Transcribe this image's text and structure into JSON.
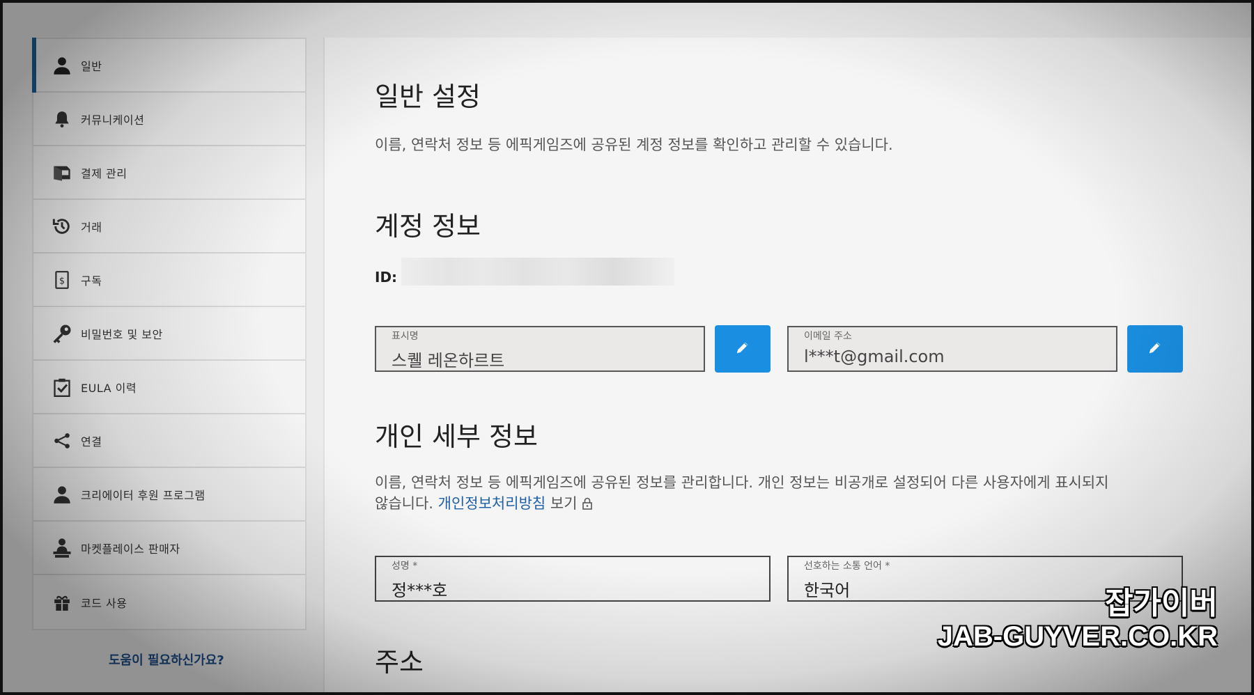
{
  "sidebar": {
    "items": [
      {
        "label": "일반",
        "icon": "user-icon",
        "active": true
      },
      {
        "label": "커뮤니케이션",
        "icon": "bell-icon"
      },
      {
        "label": "결제 관리",
        "icon": "wallet-icon"
      },
      {
        "label": "거래",
        "icon": "history-icon"
      },
      {
        "label": "구독",
        "icon": "subscription-icon"
      },
      {
        "label": "비밀번호 및 보안",
        "icon": "key-icon"
      },
      {
        "label": "EULA 이력",
        "icon": "clipboard-check-icon"
      },
      {
        "label": "연결",
        "icon": "share-icon"
      },
      {
        "label": "크리에이터 후원 프로그램",
        "icon": "creator-icon"
      },
      {
        "label": "마켓플레이스 판매자",
        "icon": "seller-icon"
      },
      {
        "label": "코드 사용",
        "icon": "gift-icon"
      }
    ],
    "help": "도움이 필요하신가요?"
  },
  "main": {
    "title": "일반 설정",
    "description": "이름, 연락처 정보 등 에픽게임즈에 공유된 계정 정보를 확인하고 관리할 수 있습니다.",
    "account_section": {
      "title": "계정 정보",
      "id_label": "ID:",
      "display_name": {
        "label": "표시명",
        "value": "스퀠 레온하르트"
      },
      "email": {
        "label": "이메일 주소",
        "value": "l***t@gmail.com"
      }
    },
    "personal_section": {
      "title": "개인 세부 정보",
      "description_1": "이름, 연락처 정보 등 에픽게임즈에 공유된 정보를 관리합니다. 개인 정보는 비공개로 설정되어 다른 사용자에게 표시되지",
      "description_2": "않습니다.",
      "privacy_link": "개인정보처리방침",
      "privacy_suffix": "보기",
      "name": {
        "label": "성명 *",
        "value": "정***호"
      },
      "language": {
        "label": "선호하는 소통 언어 *",
        "value": "한국어"
      }
    },
    "address_section": {
      "title": "주소"
    }
  },
  "watermark": {
    "line1": "잡가이버",
    "line2": "JAB-GUYVER.CO.KR"
  },
  "colors": {
    "accent": "#1a8ee0",
    "active_bar": "#1f5f93",
    "link": "#1f5fa8"
  }
}
